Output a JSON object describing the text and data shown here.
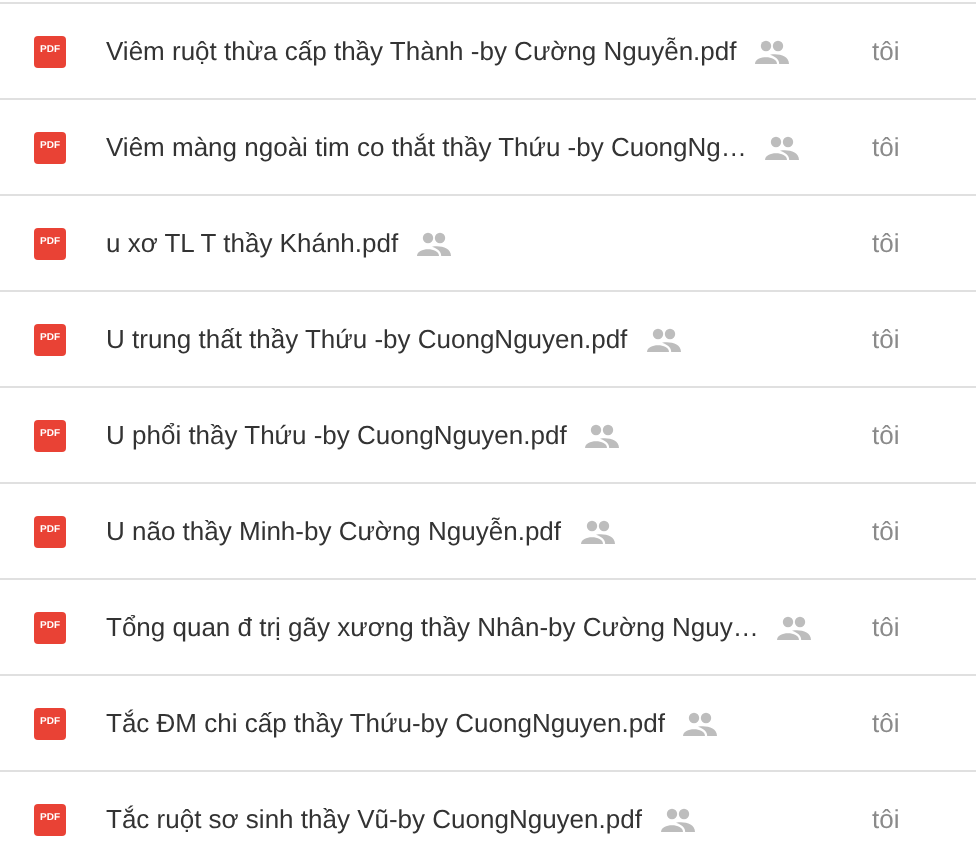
{
  "files": [
    {
      "icon_label": "PDF",
      "name": "Viêm ruột thừa cấp thầy Thành -by Cường Nguyễn.pdf",
      "shared": true,
      "owner": "tôi"
    },
    {
      "icon_label": "PDF",
      "name": "Viêm màng ngoài tim co thắt thầy Thứu -by CuongNg…",
      "shared": true,
      "owner": "tôi"
    },
    {
      "icon_label": "PDF",
      "name": "u xơ TL T thầy Khánh.pdf",
      "shared": true,
      "owner": "tôi"
    },
    {
      "icon_label": "PDF",
      "name": "U trung thất thầy Thứu -by CuongNguyen.pdf",
      "shared": true,
      "owner": "tôi"
    },
    {
      "icon_label": "PDF",
      "name": "U phổi thầy Thứu -by CuongNguyen.pdf",
      "shared": true,
      "owner": "tôi"
    },
    {
      "icon_label": "PDF",
      "name": "U não thầy Minh-by Cường Nguyễn.pdf",
      "shared": true,
      "owner": "tôi"
    },
    {
      "icon_label": "PDF",
      "name": "Tổng quan đ trị gãy xương thầy Nhân-by Cường Nguy…",
      "shared": true,
      "owner": "tôi"
    },
    {
      "icon_label": "PDF",
      "name": "Tắc ĐM chi cấp thầy Thứu-by CuongNguyen.pdf",
      "shared": true,
      "owner": "tôi"
    },
    {
      "icon_label": "PDF",
      "name": "Tắc ruột sơ sinh thầy Vũ-by CuongNguyen.pdf",
      "shared": true,
      "owner": "tôi"
    }
  ]
}
